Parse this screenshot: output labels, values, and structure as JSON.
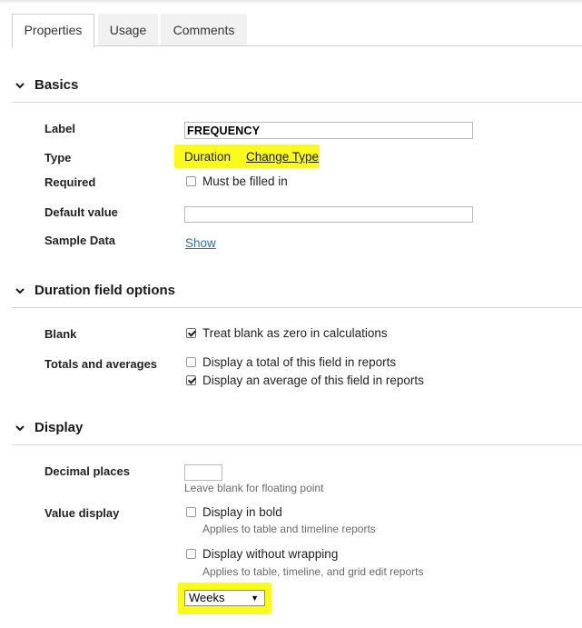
{
  "tabs": [
    {
      "label": "Properties",
      "active": true
    },
    {
      "label": "Usage",
      "active": false
    },
    {
      "label": "Comments",
      "active": false
    }
  ],
  "basics": {
    "heading": "Basics",
    "label_field": {
      "label": "Label",
      "value": "FREQUENCY"
    },
    "type_field": {
      "label": "Type",
      "value": "Duration",
      "change_link": "Change Type"
    },
    "required_field": {
      "label": "Required",
      "checkbox_label": "Must be filled in",
      "checked": false
    },
    "default_field": {
      "label": "Default value",
      "value": ""
    },
    "sample_field": {
      "label": "Sample Data",
      "link": "Show"
    }
  },
  "duration": {
    "heading": "Duration field options",
    "blank": {
      "label": "Blank",
      "checkbox_label": "Treat blank as zero in calculations",
      "checked": true
    },
    "totals": {
      "label": "Totals and averages",
      "total_label": "Display a total of this field in reports",
      "total_checked": false,
      "average_label": "Display an average of this field in reports",
      "average_checked": true
    }
  },
  "display": {
    "heading": "Display",
    "decimal": {
      "label": "Decimal places",
      "value": "",
      "hint": "Leave blank for floating point"
    },
    "value_display": {
      "label": "Value display",
      "bold_label": "Display in bold",
      "bold_checked": false,
      "bold_hint": "Applies to table and timeline reports",
      "wrap_label": "Display without wrapping",
      "wrap_checked": false,
      "wrap_hint": "Applies to table, timeline, and grid edit reports",
      "unit_selected": "Weeks"
    }
  },
  "colors": {
    "highlight": "#fbfb1b",
    "link": "#2d6fb5"
  }
}
